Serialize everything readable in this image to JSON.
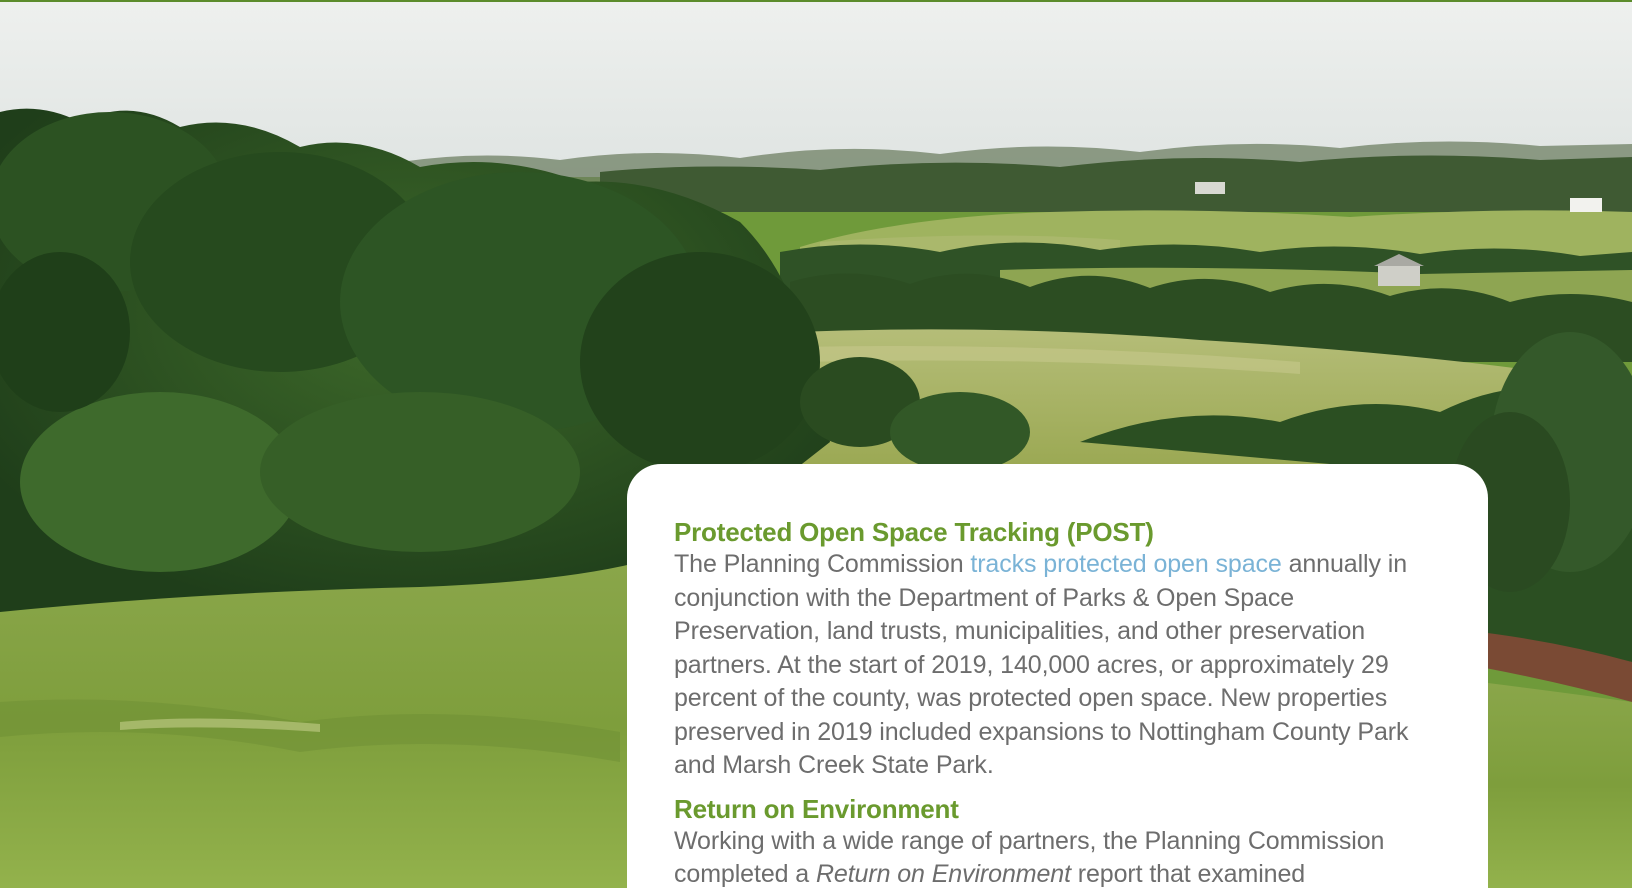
{
  "hero": {
    "description": "",
    "icon": "landscape-photo"
  },
  "colors": {
    "accent_green": "#6a9a2e",
    "link_blue": "#7ab3d6",
    "body_gray": "#6d6d6d",
    "top_rule": "#5c8c2c"
  },
  "sections": [
    {
      "heading": "Protected Open Space Tracking (POST)",
      "body_before_link": "The Planning Commission ",
      "link_text": "tracks protected open space",
      "body_after_link": " annually in conjunction with the Department of Parks & Open Space Preservation, land trusts, municipalities, and other preservation partners. At the start of 2019, 140,000 acres, or approximately 29 percent of the county, was protected open space. New properties preserved in 2019 included expansions to Nottingham County Park and Marsh Creek State Park."
    },
    {
      "heading": "Return on Environment",
      "body_before_em": "Working with a wide range of partners, the Planning Commission completed a ",
      "em_text": "Return on Environment",
      "body_after_em": " report that examined"
    }
  ]
}
